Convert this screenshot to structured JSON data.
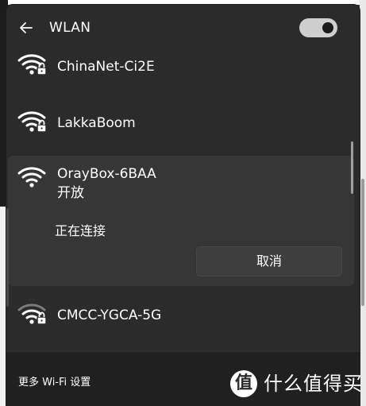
{
  "header": {
    "title": "WLAN",
    "back_icon": "arrow-left-icon",
    "toggle_state": "on"
  },
  "networks": [
    {
      "ssid": "ChinaNet-Ci2E",
      "secured": true,
      "icon": "wifi-lock-icon"
    },
    {
      "ssid": "LakkaBoom",
      "secured": true,
      "icon": "wifi-lock-icon"
    },
    {
      "ssid": "OrayBox-6BAA",
      "secured": false,
      "icon": "wifi-icon",
      "detail": "开放",
      "status": "正在连接",
      "action_label": "取消"
    },
    {
      "ssid": "CMCC-YGCA-5G",
      "secured": true,
      "icon": "wifi-lock-icon"
    }
  ],
  "footer": {
    "more_settings": "更多 Wi-Fi 设置"
  },
  "watermark": {
    "logo_glyph": "值",
    "text": "什么值得买"
  },
  "colors": {
    "panel": "#2b2b2b",
    "selected": "#363636",
    "footer": "#202020",
    "button": "#3e3e3e",
    "text": "#ffffff",
    "toggle": "#cfcfcf"
  }
}
